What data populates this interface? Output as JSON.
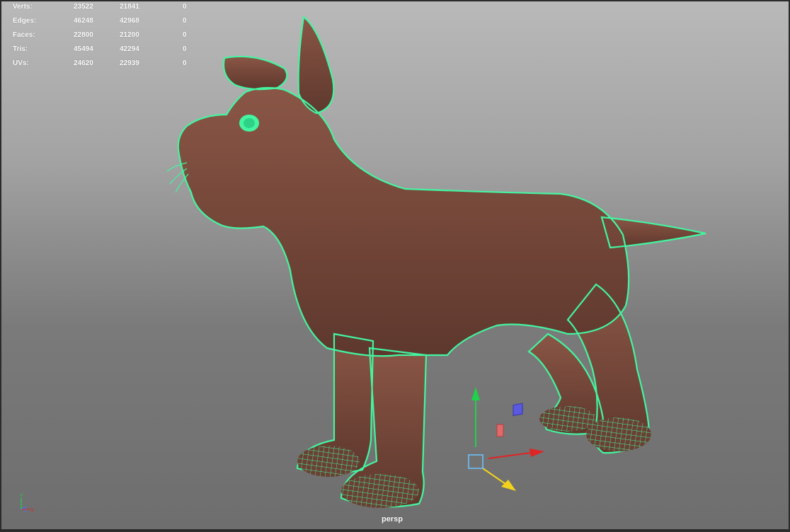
{
  "hud": {
    "rows": [
      {
        "label": "Verts:",
        "total": "23522",
        "selected": "21841",
        "component": "0"
      },
      {
        "label": "Edges:",
        "total": "46248",
        "selected": "42968",
        "component": "0"
      },
      {
        "label": "Faces:",
        "total": "22800",
        "selected": "21200",
        "component": "0"
      },
      {
        "label": "Tris:",
        "total": "45494",
        "selected": "42294",
        "component": "0"
      },
      {
        "label": "UVs:",
        "total": "24620",
        "selected": "22939",
        "component": "0"
      }
    ]
  },
  "viewport": {
    "camera": "persp",
    "axes": {
      "y": "Y",
      "z": "Z",
      "x": "X"
    },
    "colors": {
      "wireframe": "#43f5a0",
      "mesh": "#7a4a3c",
      "background_top": "#b9b9b9",
      "background_bottom": "#6e6e6e",
      "axis_x": "#e02424",
      "axis_y": "#1fd24a",
      "axis_z": "#f2d21c",
      "gizmo_center": "#6ec6ff"
    }
  }
}
